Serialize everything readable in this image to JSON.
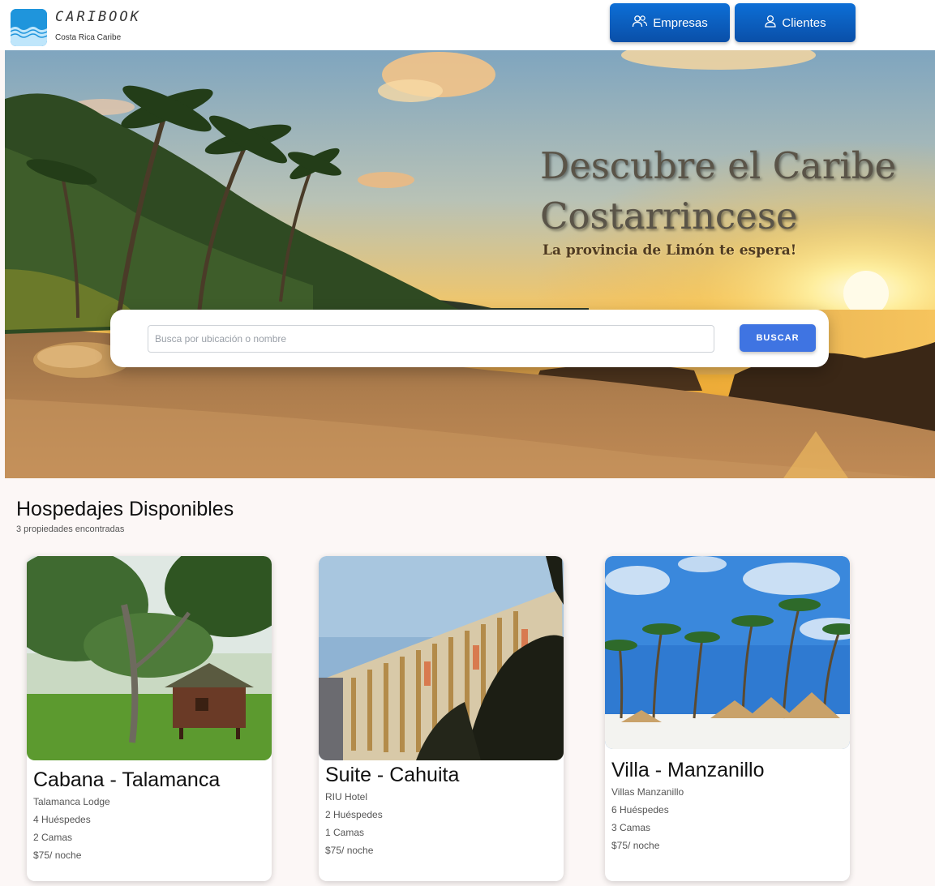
{
  "header": {
    "brand_title": "CARIBOOK",
    "brand_subtitle": "Costa Rica Caribe",
    "nav": {
      "empresas_label": "Empresas",
      "clientes_label": "Clientes"
    }
  },
  "hero": {
    "title_line1": "Descubre  el Caribe",
    "title_line2": "Costarrincese",
    "subtitle": "La provincia de Limón te espera!",
    "search": {
      "placeholder": "Busca por ubicación o nombre",
      "button_label": "BUSCAR"
    }
  },
  "listings": {
    "title": "Hospedajes Disponibles",
    "count_text": "3 propiedades encontradas",
    "items": [
      {
        "title": "Cabana - Talamanca",
        "provider": "Talamanca Lodge",
        "guests": "4 Huéspedes",
        "beds": "2 Camas",
        "price": "$75/ noche"
      },
      {
        "title": "Suite - Cahuita",
        "provider": "RIU Hotel",
        "guests": "2 Huéspedes",
        "beds": "1 Camas",
        "price": "$75/ noche"
      },
      {
        "title": "Villa - Manzanillo",
        "provider": "Villas Manzanillo",
        "guests": "6 Huéspedes",
        "beds": "3 Camas",
        "price": "$75/ noche"
      }
    ]
  },
  "colors": {
    "nav_button": "#0b5fc0",
    "search_button": "#3f74e2",
    "page_background": "#fcf7f6"
  }
}
